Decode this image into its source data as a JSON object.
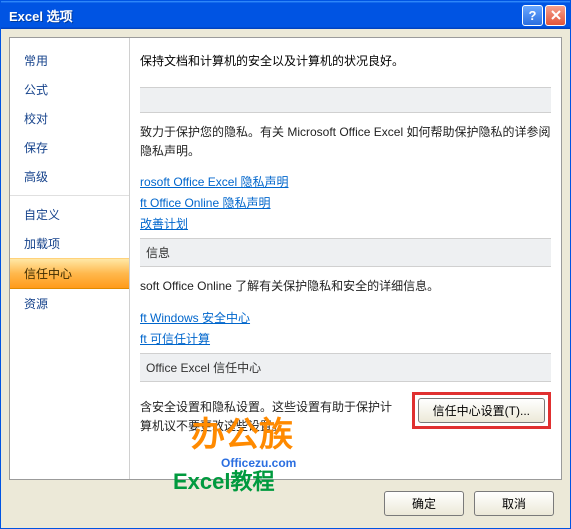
{
  "window": {
    "title": "Excel 选项"
  },
  "sidebar": {
    "items": [
      {
        "label": "常用"
      },
      {
        "label": "公式"
      },
      {
        "label": "校对"
      },
      {
        "label": "保存"
      },
      {
        "label": "高级"
      },
      {
        "label": "自定义"
      },
      {
        "label": "加载项"
      },
      {
        "label": "信任中心"
      },
      {
        "label": "资源"
      }
    ],
    "selected_index": 7
  },
  "content": {
    "intro": "保持文档和计算机的安全以及计算机的状况良好。",
    "privacy": {
      "text": "致力于保护您的隐私。有关 Microsoft Office Excel 如何帮助保护隐私的详参阅隐私声明。",
      "links": [
        "rosoft Office Excel 隐私声明",
        "ft Office Online 隐私声明",
        "改善计划"
      ]
    },
    "info": {
      "header": "信息",
      "text": "soft Office Online 了解有关保护隐私和安全的详细信息。",
      "links": [
        "ft Windows 安全中心",
        "ft 可信任计算"
      ]
    },
    "trust": {
      "header": "Office Excel 信任中心",
      "text": "含安全设置和隐私设置。这些设置有助于保护计算机议不要更改这些设置。",
      "button": "信任中心设置(T)..."
    }
  },
  "footer": {
    "ok": "确定",
    "cancel": "取消"
  },
  "watermark": {
    "line1": "办公族",
    "line2": "Officezu.com",
    "line3": "Excel教程"
  }
}
